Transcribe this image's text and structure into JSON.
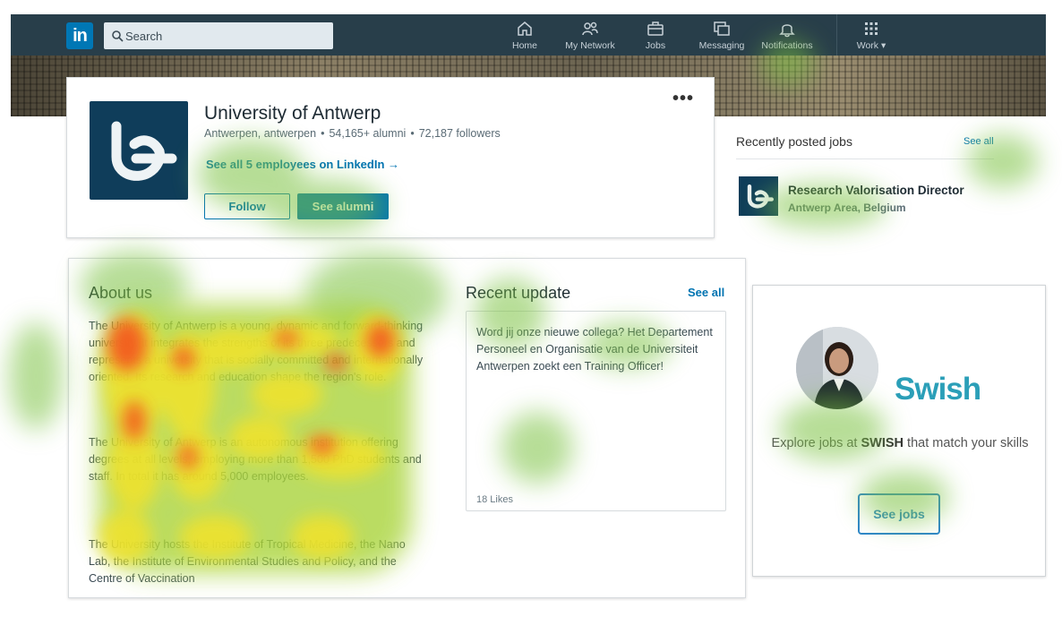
{
  "nav": {
    "logo_text": "in",
    "search_placeholder": "Search",
    "items": [
      {
        "label": "Home",
        "icon": "home-icon"
      },
      {
        "label": "My Network",
        "icon": "network-icon"
      },
      {
        "label": "Jobs",
        "icon": "briefcase-icon"
      },
      {
        "label": "Messaging",
        "icon": "messaging-icon"
      },
      {
        "label": "Notifications",
        "icon": "bell-icon"
      },
      {
        "label": "Work ▾",
        "icon": "grid-icon"
      }
    ],
    "colors": {
      "bar": "#283e4a",
      "logo": "#0077b5"
    }
  },
  "company": {
    "name": "University of Antwerp",
    "location": "Antwerpen, antwerpen",
    "alumni": "54,165+ alumni",
    "followers": "72,187 followers",
    "employees_link": "See all 5 employees on LinkedIn →",
    "follow_label": "Follow",
    "alumni_label": "See alumni",
    "more_label": "•••"
  },
  "jobs": {
    "title": "Recently posted jobs",
    "see_all": "See all",
    "items": [
      {
        "title": "Research Valorisation Director",
        "location": "Antwerp Area, Belgium"
      }
    ]
  },
  "about": {
    "heading": "About us",
    "p1": "The University of Antwerp is a young, dynamic and forward-thinking university. It integrates the strengths of its three predecessors and represents a university that is socially committed and internationally oriented. Its research and education shape the region's role.",
    "p2": "The University of Antwerp is an autonomous institution offering degrees at all levels, employing more than 1,500 PhD students and staff. In total it has around 5,000 employees.",
    "p3": "The University hosts the Institute of Tropical Medicine, the Nano Lab, the Institute of Environmental Studies and Policy, and the Centre of Vaccination"
  },
  "recent": {
    "heading": "Recent update",
    "see_all": "See all",
    "text": "Word jij onze nieuwe collega? Het Departement Personeel en Organisatie van de Universiteit Antwerpen zoekt een Training Officer!",
    "likes": "18 Likes"
  },
  "ad": {
    "brand": "Swish",
    "text_prefix": "Explore jobs at ",
    "text_brand": "SWISH",
    "text_suffix": " that match your skills",
    "button": "See jobs",
    "colors": {
      "brand": "#2b9fb8",
      "button": "#2e86c9"
    }
  },
  "heatmap": {
    "colors": {
      "low": "#7cc242",
      "mid": "#f2e22a",
      "high": "#f44b1b"
    }
  }
}
